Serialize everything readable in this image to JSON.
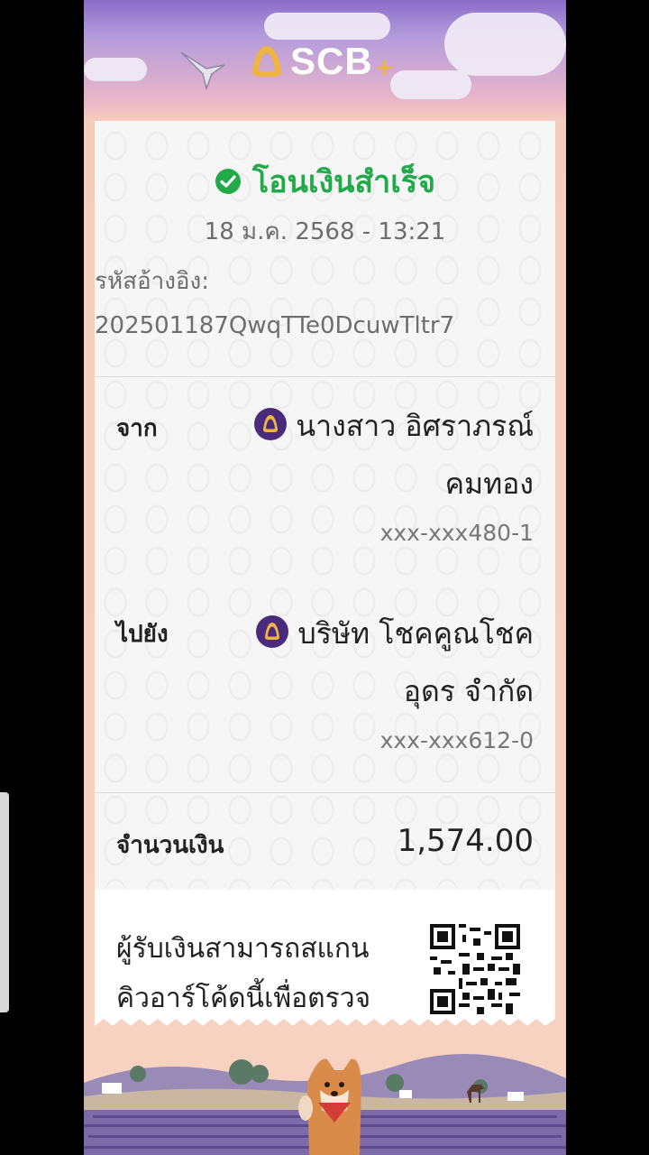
{
  "brand": {
    "name": "SCB",
    "plus": "+"
  },
  "status": {
    "text": "โอนเงินสำเร็จ"
  },
  "datetime": "18 ม.ค. 2568 - 13:21",
  "reference": {
    "label": "รหัสอ้างอิง:",
    "value": "202501187QwqTTe0DcuwTltr7"
  },
  "from": {
    "label": "จาก",
    "name_line1": "นางสาว อิศราภรณ์",
    "name_line2": "คมทอง",
    "account": "xxx-xxx480-1"
  },
  "to": {
    "label": "ไปยัง",
    "name_line1": "บริษัท โชคคูณโชค",
    "name_line2": "อุดร จำกัด",
    "account": "xxx-xxx612-0"
  },
  "amount": {
    "label": "จำนวนเงิน",
    "value": "1,574.00"
  },
  "qr": {
    "line1": "ผู้รับเงินสามารถสแกน",
    "line2": "คิวอาร์โค้ดนี้เพื่อตรวจ"
  },
  "colors": {
    "success": "#21a94a",
    "brand_purple": "#4a2a7a",
    "brand_gold": "#f0b443"
  }
}
